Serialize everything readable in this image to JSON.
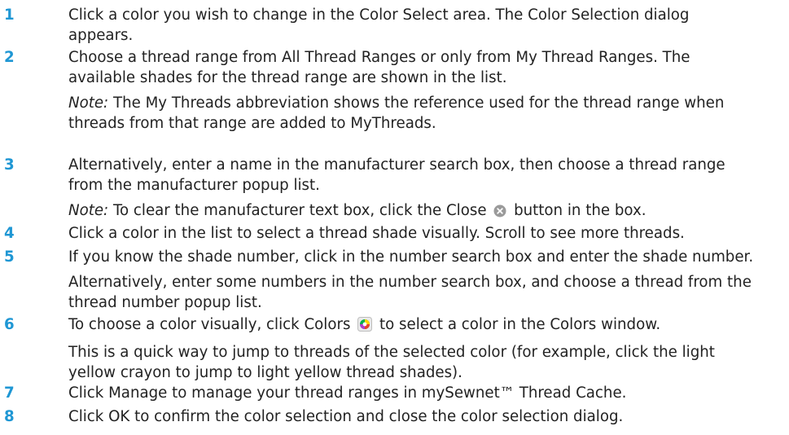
{
  "steps": [
    {
      "num": "1",
      "lines": [
        "Click a color you wish to change in the Color Select area. The Color Selection dialog",
        "appears."
      ]
    },
    {
      "num": "2",
      "lines": [
        "Choose a thread range from All Thread Ranges or only from My Thread Ranges. The",
        "available shades for the thread range are shown in the list."
      ],
      "note": {
        "label": "Note:",
        "lines": [
          " The My Threads abbreviation shows the reference used for the thread range when",
          "threads from that range are added to MyThreads."
        ]
      }
    },
    {
      "num": "3",
      "lines": [
        "Alternatively, enter a name in the manufacturer search box, then choose a thread range",
        "from the manufacturer popup list."
      ],
      "note": {
        "label": "Note:",
        "before": " To clear the manufacturer text box, click the Close ",
        "after": " button in the box."
      }
    },
    {
      "num": "4",
      "lines": [
        "Click a color in the list to select a thread shade visually. Scroll to see more threads."
      ]
    },
    {
      "num": "5",
      "lines": [
        "If you know the shade number, click in the number search box and enter the shade number."
      ],
      "extra": [
        "Alternatively, enter some numbers in the number search box, and choose a thread from the",
        "thread number popup list."
      ]
    },
    {
      "num": "6",
      "before": "To choose a color visually, click Colors ",
      "after": " to select a color in the Colors window.",
      "extra": [
        "This is a quick way to jump to threads of the selected color (for example, click the light",
        "yellow crayon to jump to light yellow thread shades)."
      ]
    },
    {
      "num": "7",
      "lines": [
        "Click Manage to manage your thread ranges in mySewnet™  Thread Cache."
      ]
    },
    {
      "num": "8",
      "lines": [
        "Click OK to confirm the color selection and close the color selection dialog."
      ]
    }
  ],
  "icons": {
    "close": "close-circle-icon",
    "colors": "color-wheel-icon"
  },
  "colors": {
    "step_number": "#1f97d4",
    "text": "#222222"
  }
}
